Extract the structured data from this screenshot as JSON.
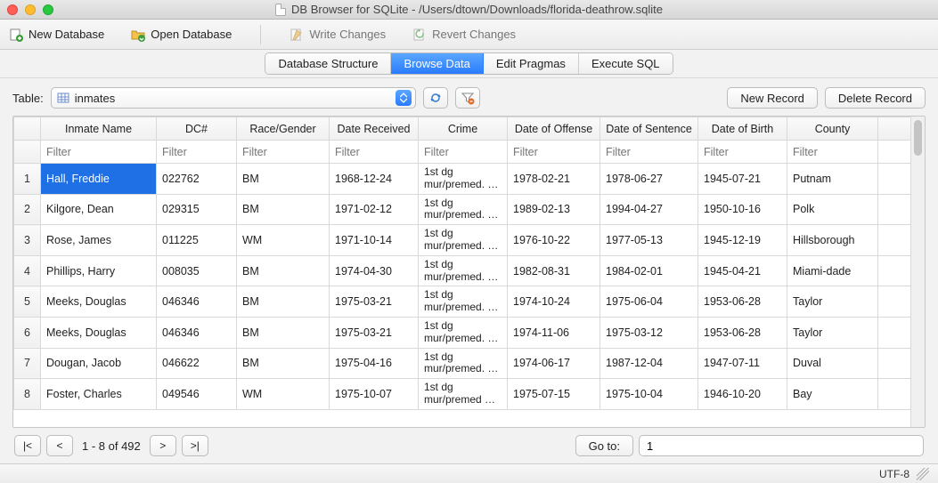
{
  "window": {
    "title": "DB Browser for SQLite - /Users/dtown/Downloads/florida-deathrow.sqlite"
  },
  "toolbar": {
    "new_db": "New Database",
    "open_db": "Open Database",
    "write_changes": "Write Changes",
    "revert_changes": "Revert Changes"
  },
  "tabs": {
    "structure": "Database Structure",
    "browse": "Browse Data",
    "pragmas": "Edit Pragmas",
    "execute": "Execute SQL"
  },
  "browse": {
    "table_label": "Table:",
    "table_name": "inmates",
    "new_record": "New Record",
    "delete_record": "Delete Record"
  },
  "columns": [
    "Inmate Name",
    "DC#",
    "Race/Gender",
    "Date Received",
    "Crime",
    "Date of Offense",
    "Date of Sentence",
    "Date of Birth",
    "County"
  ],
  "filter_placeholder": "Filter",
  "rows": [
    {
      "n": "1",
      "name": "Hall, Freddie",
      "dc": "022762",
      "rg": "BM",
      "recv": "1968-12-24",
      "crime": "1st dg mur/premed. …",
      "off": "1978-02-21",
      "sent": "1978-06-27",
      "dob": "1945-07-21",
      "county": "Putnam",
      "sel_name": true
    },
    {
      "n": "2",
      "name": "Kilgore, Dean",
      "dc": "029315",
      "rg": "BM",
      "recv": "1971-02-12",
      "crime": "1st dg mur/premed. …",
      "off": "1989-02-13",
      "sent": "1994-04-27",
      "dob": "1950-10-16",
      "county": "Polk"
    },
    {
      "n": "3",
      "name": "Rose, James",
      "dc": "011225",
      "rg": "WM",
      "recv": "1971-10-14",
      "crime": "1st dg mur/premed. …",
      "off": "1976-10-22",
      "sent": "1977-05-13",
      "dob": "1945-12-19",
      "county": "Hillsborough"
    },
    {
      "n": "4",
      "name": "Phillips, Harry",
      "dc": "008035",
      "rg": "BM",
      "recv": "1974-04-30",
      "crime": "1st dg mur/premed. …",
      "off": "1982-08-31",
      "sent": "1984-02-01",
      "dob": "1945-04-21",
      "county": "Miami-dade"
    },
    {
      "n": "5",
      "name": "Meeks, Douglas",
      "dc": "046346",
      "rg": "BM",
      "recv": "1975-03-21",
      "crime": "1st dg mur/premed. …",
      "off": "1974-10-24",
      "sent": "1975-06-04",
      "dob": "1953-06-28",
      "county": "Taylor"
    },
    {
      "n": "6",
      "name": "Meeks, Douglas",
      "dc": "046346",
      "rg": "BM",
      "recv": "1975-03-21",
      "crime": "1st dg mur/premed. …",
      "off": "1974-11-06",
      "sent": "1975-03-12",
      "dob": "1953-06-28",
      "county": "Taylor"
    },
    {
      "n": "7",
      "name": "Dougan, Jacob",
      "dc": "046622",
      "rg": "BM",
      "recv": "1975-04-16",
      "crime": "1st dg mur/premed. …",
      "off": "1974-06-17",
      "sent": "1987-12-04",
      "dob": "1947-07-11",
      "county": "Duval"
    },
    {
      "n": "8",
      "name": "Foster, Charles",
      "dc": "049546",
      "rg": "WM",
      "recv": "1975-10-07",
      "crime": "1st dg mur/premed …",
      "off": "1975-07-15",
      "sent": "1975-10-04",
      "dob": "1946-10-20",
      "county": "Bay"
    }
  ],
  "pager": {
    "first": "|<",
    "prev": "<",
    "range": "1 - 8 of 492",
    "next": ">",
    "last": ">|",
    "goto_label": "Go to:",
    "goto_value": "1"
  },
  "status": {
    "encoding": "UTF-8"
  }
}
